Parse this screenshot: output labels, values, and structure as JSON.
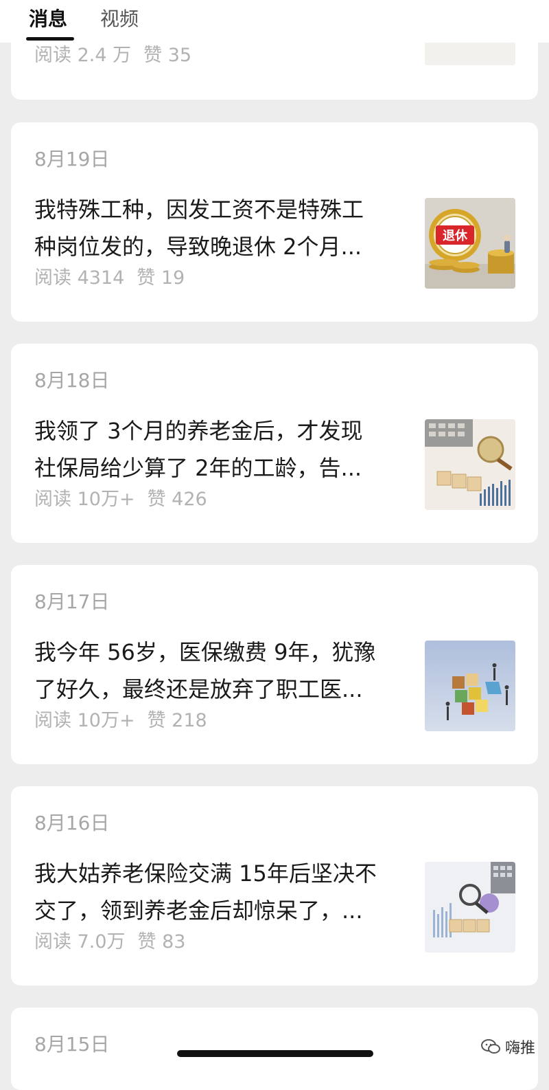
{
  "tabs": [
    {
      "label": "消息",
      "active": true
    },
    {
      "label": "视频",
      "active": false
    }
  ],
  "articles": [
    {
      "date": "",
      "title_lines": [],
      "reads": "阅读 2.4 万",
      "likes": "赞 35",
      "thumb_icon": "coins-icon"
    },
    {
      "date": "8月19日",
      "title_lines": [
        "我特殊工种，因发工资不是特殊工",
        "种岗位发的，导致晚退休 2个月..."
      ],
      "reads": "阅读 4314",
      "likes": "赞 19",
      "thumb_icon": "retirement-coins-icon"
    },
    {
      "date": "8月18日",
      "title_lines": [
        "我领了 3个月的养老金后，才发现",
        "社保局给少算了 2年的工龄，告..."
      ],
      "reads": "阅读 10万+",
      "likes": "赞 426",
      "thumb_icon": "pension-chart-icon"
    },
    {
      "date": "8月17日",
      "title_lines": [
        "我今年 56岁，医保缴费 9年，犹豫",
        "了好久，最终还是放弃了职工医..."
      ],
      "reads": "阅读 10万+",
      "likes": "赞 218",
      "thumb_icon": "medical-insurance-blocks-icon"
    },
    {
      "date": "8月16日",
      "title_lines": [
        "我大姑养老保险交满 15年后坚决不",
        "交了，领到养老金后却惊呆了，..."
      ],
      "reads": "阅读 7.0万",
      "likes": "赞 83",
      "thumb_icon": "pension-magnifier-icon"
    },
    {
      "date": "8月15日",
      "title_lines": [],
      "reads": "",
      "likes": "",
      "thumb_icon": ""
    }
  ],
  "watermark": {
    "label": "嗨推",
    "icon": "wechat-logo-icon"
  },
  "colors": {
    "background": "#ededed",
    "card": "#ffffff",
    "muted_text": "#b2b2b2",
    "retire_red": "#d8262b"
  }
}
